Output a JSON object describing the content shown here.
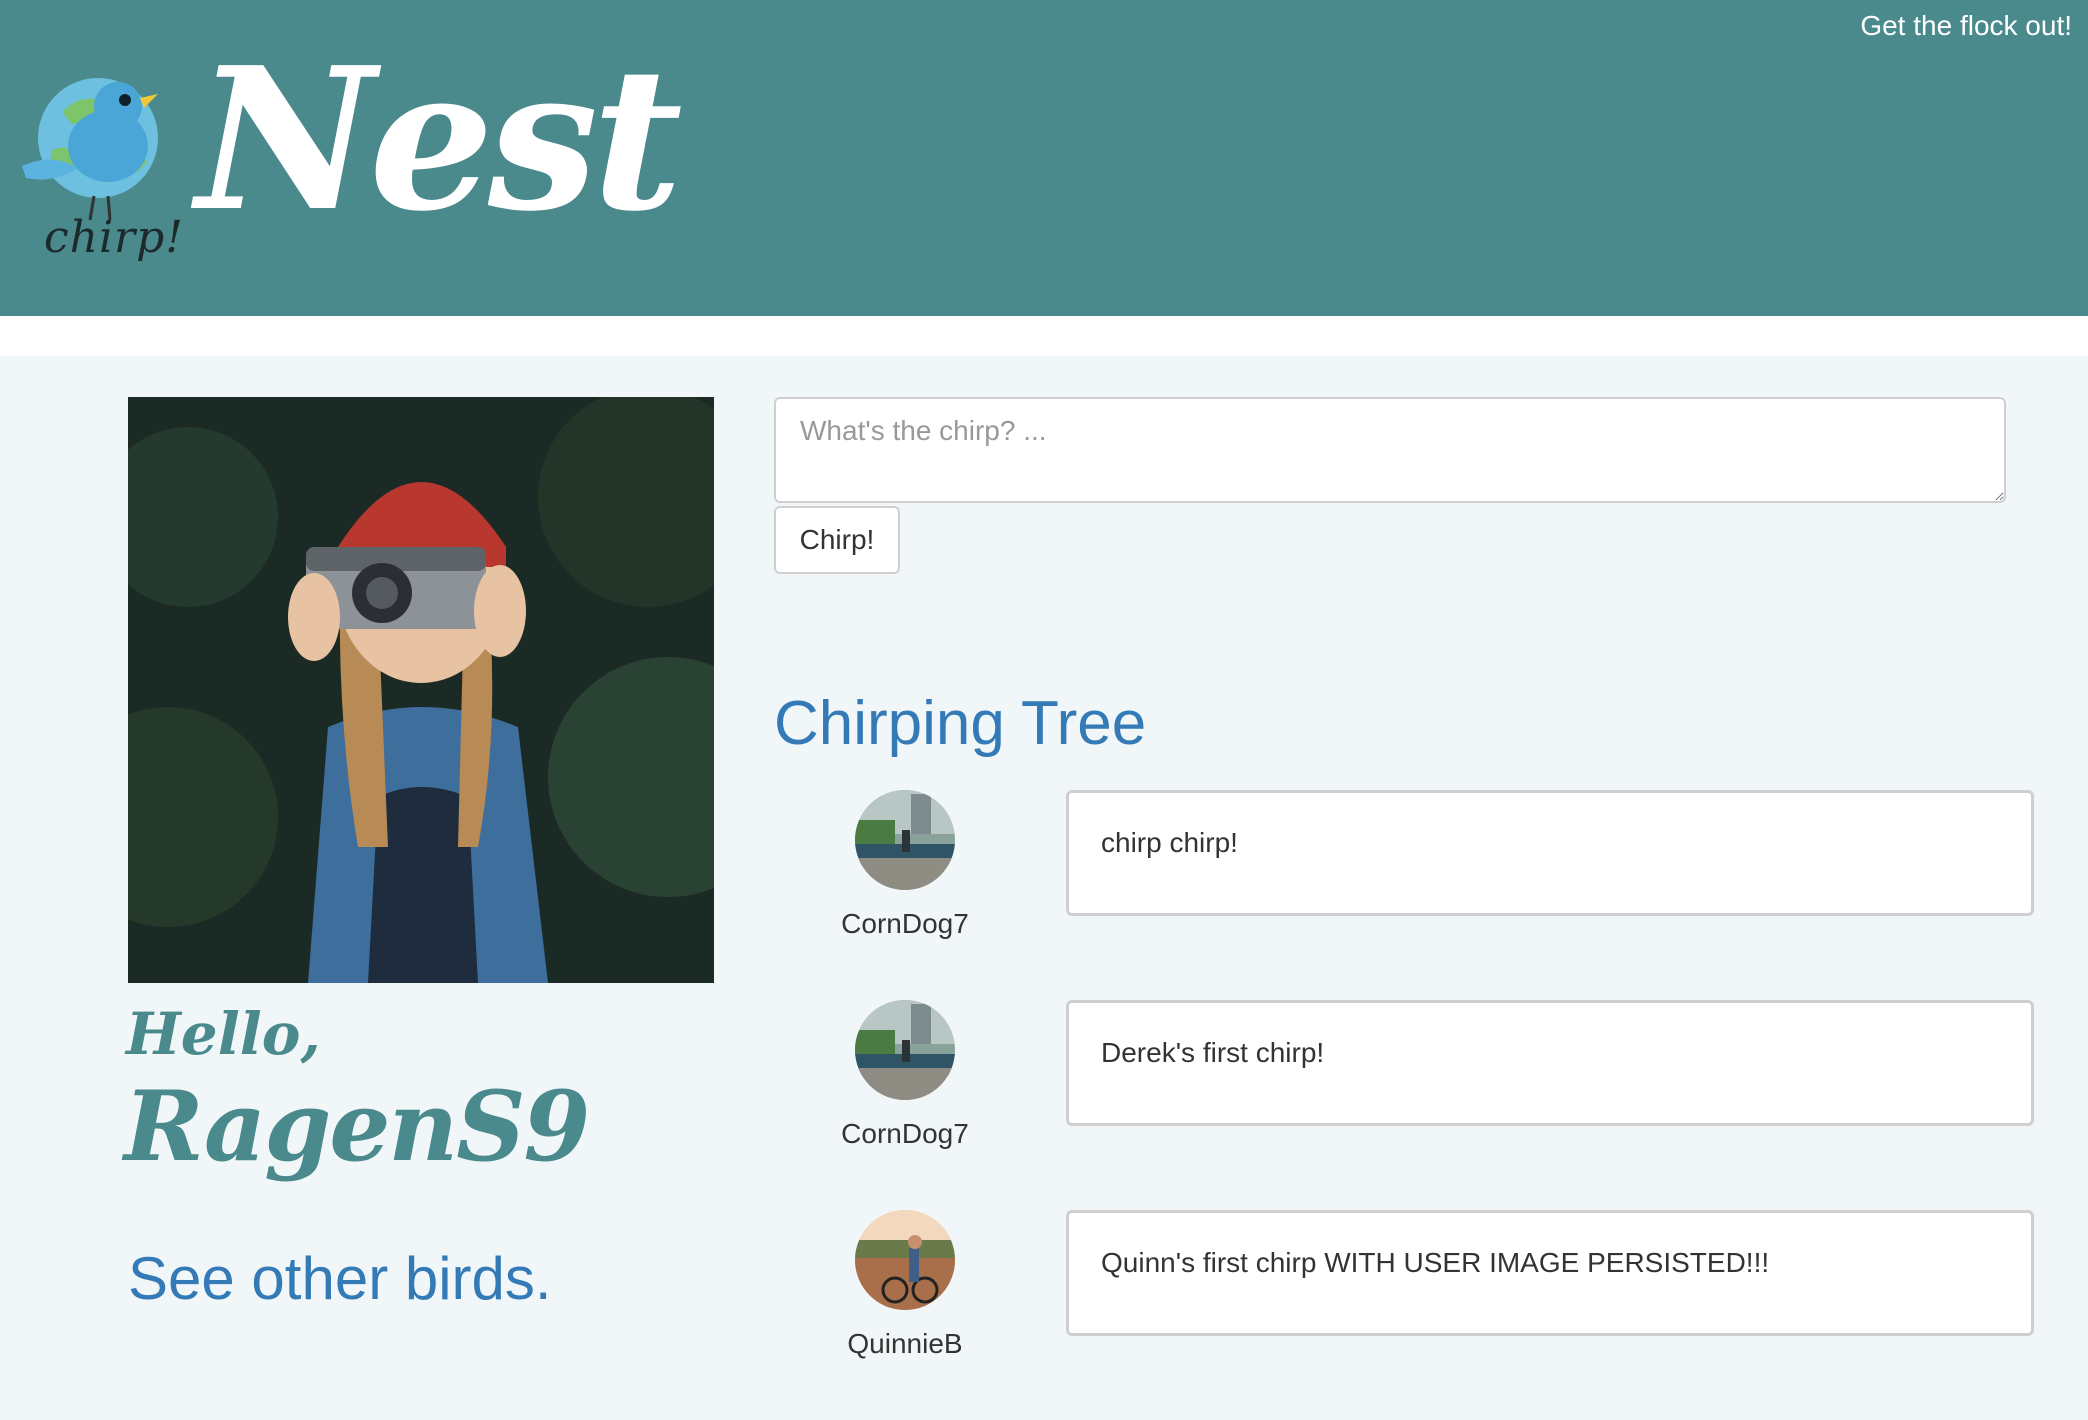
{
  "header": {
    "brand": "Nest",
    "logo_caption": "chirp!",
    "logout_label": "Get the flock out!",
    "background_color": "#4a898c"
  },
  "profile": {
    "greeting": "Hello,",
    "username": "RagenS9",
    "see_other_label": "See other birds."
  },
  "composer": {
    "placeholder": "What's the chirp? ...",
    "value": "",
    "button_label": "Chirp!"
  },
  "feed": {
    "title": "Chirping Tree",
    "items": [
      {
        "author": "CornDog7",
        "text": "chirp chirp!"
      },
      {
        "author": "CornDog7",
        "text": "Derek's first chirp!"
      },
      {
        "author": "QuinnieB",
        "text": "Quinn's first chirp WITH USER IMAGE PERSISTED!!!"
      }
    ]
  },
  "colors": {
    "accent": "#4a898c",
    "link": "#337ab7",
    "page_background": "#f1f7f9"
  }
}
